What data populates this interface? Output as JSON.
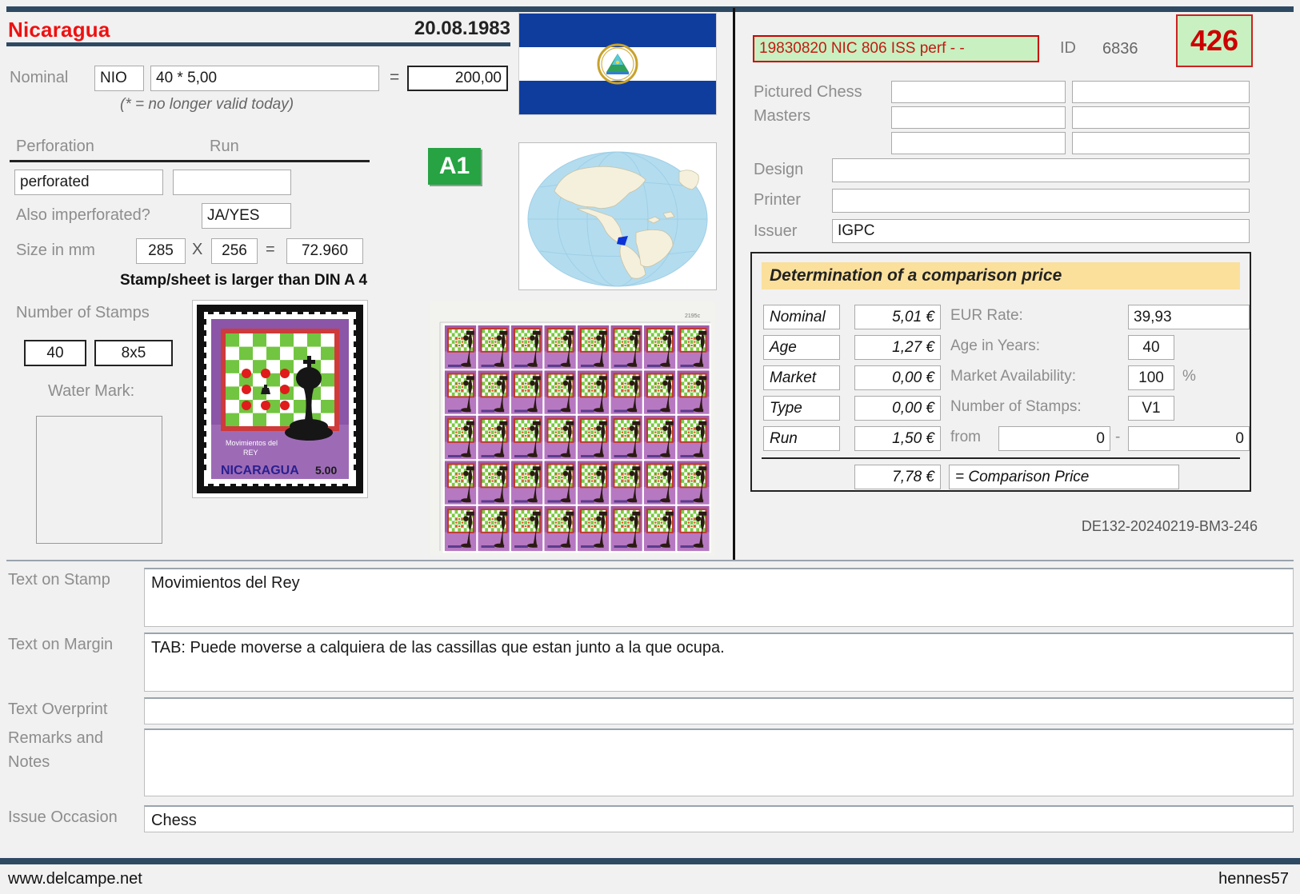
{
  "header": {
    "country": "Nicaragua",
    "issue_date": "20.08.1983"
  },
  "nominal": {
    "label": "Nominal",
    "currency": "NIO",
    "expression": "40 * 5,00",
    "equals_sign": "=",
    "total": "200,00",
    "note": "(* = no longer valid today)"
  },
  "perforation": {
    "label": "Perforation",
    "value": "perforated",
    "run_label": "Run",
    "run_value": "",
    "also_imperforated_label": "Also imperforated?",
    "also_imperforated_value": "JA/YES"
  },
  "size": {
    "label": "Size in mm",
    "width": "285",
    "x_sign": "X",
    "height": "256",
    "equals_sign": "=",
    "area": "72.960",
    "note": "Stamp/sheet is larger than DIN A 4"
  },
  "stamps": {
    "label": "Number of Stamps",
    "count": "40",
    "grid": "8x5"
  },
  "watermark": {
    "label": "Water Mark:",
    "value": ""
  },
  "badges": {
    "quality": "A1",
    "number": "426"
  },
  "right": {
    "code": "19830820 NIC 806 ISS perf - -",
    "id_label": "ID",
    "id_value": "6836",
    "pictured_label_line1": "Pictured Chess",
    "pictured_label_line2": "Masters",
    "pictured_values": [
      "",
      "",
      "",
      "",
      "",
      ""
    ],
    "design_label": "Design",
    "design_value": "",
    "printer_label": "Printer",
    "printer_value": "",
    "issuer_label": "Issuer",
    "issuer_value": "IGPC",
    "reference_code": "DE132-20240219-BM3-246"
  },
  "comparison": {
    "title": "Determination of a comparison price",
    "rows": [
      {
        "name": "Nominal",
        "amount": "5,01 €",
        "side_label": "EUR Rate:",
        "side_value": "39,93",
        "suffix": ""
      },
      {
        "name": "Age",
        "amount": "1,27 €",
        "side_label": "Age in Years:",
        "side_value": "40",
        "suffix": ""
      },
      {
        "name": "Market",
        "amount": "0,00 €",
        "side_label": "Market Availability:",
        "side_value": "100",
        "suffix": "%"
      },
      {
        "name": "Type",
        "amount": "0,00 €",
        "side_label": "Number of Stamps:",
        "side_value": "V1",
        "suffix": ""
      },
      {
        "name": "Run",
        "amount": "1,50 €",
        "side_label": "from",
        "side_value": "0",
        "suffix": "-"
      }
    ],
    "from_second_value": "0",
    "total_amount": "7,78 €",
    "total_label": "= Comparison Price"
  },
  "text_fields": [
    {
      "label": "Text on Stamp",
      "value": "Movimientos del Rey"
    },
    {
      "label": "Text on Margin",
      "value": "TAB: Puede moverse a calquiera de las cassillas que estan junto a la que ocupa."
    },
    {
      "label": "Text Overprint",
      "value": ""
    },
    {
      "label": "Remarks and",
      "label2": "Notes",
      "value": ""
    },
    {
      "label": "Issue Occasion",
      "value": "Chess"
    }
  ],
  "footer": {
    "left": "www.delcampe.net",
    "right": "hennes57"
  },
  "stamp_art": {
    "caption_line1": "Movimientos del",
    "caption_line2": "REY",
    "country": "NICARAGUA",
    "denomination": "5.00",
    "currency_symbol": "₡"
  },
  "colors": {
    "accent_bar": "#2e4a63",
    "country_red": "#ee1111",
    "badge_green": "#27a343",
    "badge_bg": "#c8f0c1",
    "badge_red": "#cc0000",
    "panel_title_bg": "#fbe09b"
  }
}
